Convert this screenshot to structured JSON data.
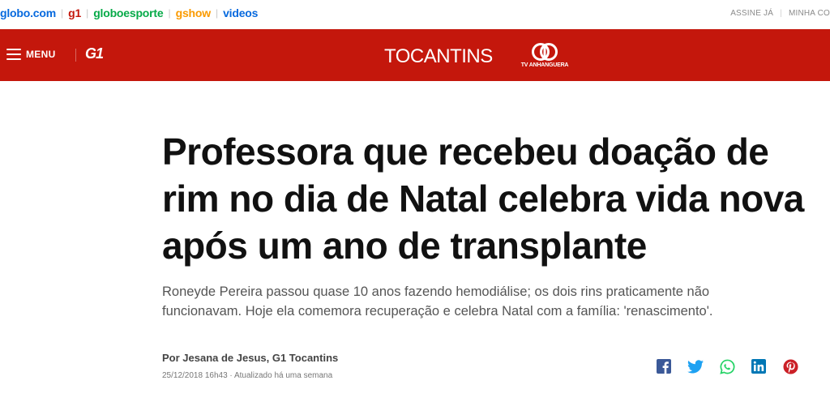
{
  "colors": {
    "header_red": "#c4170c",
    "globo": "#0669de",
    "g1": "#c4170c",
    "globoesporte": "#06aa48",
    "gshow": "#fa9a00",
    "videos": "#0669de",
    "facebook": "#3b5998",
    "twitter": "#1da1f2",
    "whatsapp": "#25d366",
    "linkedin": "#0077b5",
    "pinterest": "#cb2027"
  },
  "topbar": {
    "links": {
      "globo": "globo.com",
      "g1": "g1",
      "globoesporte": "globoesporte",
      "gshow": "gshow",
      "videos": "videos"
    },
    "assine": "ASSINE JÁ",
    "minha_conta": "MINHA CO"
  },
  "header": {
    "menu_label": "MENU",
    "logo": "G1",
    "region": "TOCANTINS",
    "tv_name": "TV ANHANGUERA"
  },
  "article": {
    "title": "Professora que recebeu doação de rim no dia de Natal celebra vida nova após um ano de transplante",
    "subtitle": "Roneyde Pereira passou quase 10 anos fazendo hemodiálise; os dois rins praticamente não funcionavam. Hoje ela comemora recuperação e celebra Natal com a família: 'renascimento'.",
    "byline": "Por Jesana de Jesus, G1 Tocantins",
    "date": "25/12/2018 16h43 · Atualizado há uma semana"
  },
  "share": [
    "facebook-icon",
    "twitter-icon",
    "whatsapp-icon",
    "linkedin-icon",
    "pinterest-icon"
  ]
}
